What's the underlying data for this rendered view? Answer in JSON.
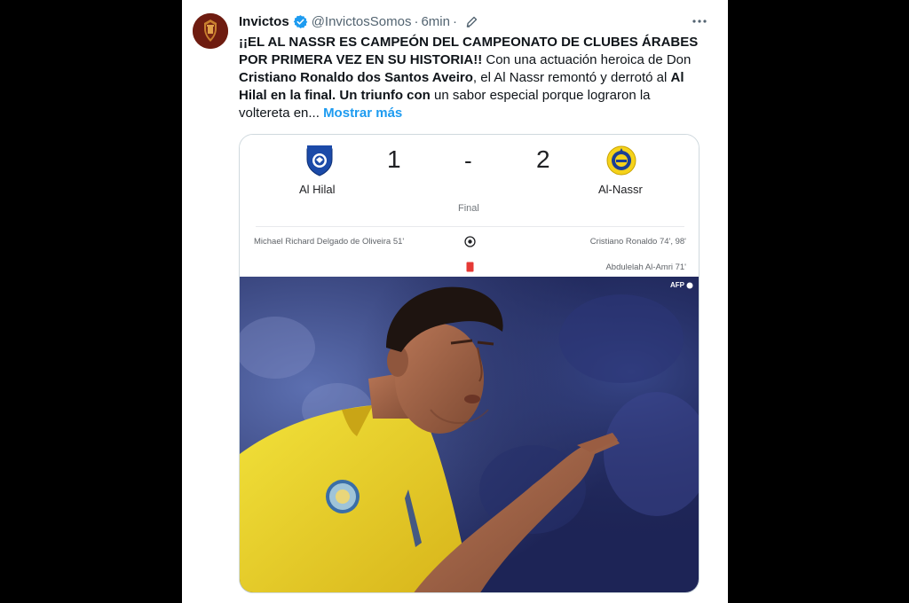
{
  "tweet": {
    "author": {
      "display_name": "Invictos",
      "handle": "@InvictosSomos",
      "verified": true
    },
    "timestamp": "6min",
    "text_bold_1": "¡¡EL AL NASSR ES CAMPEÓN DEL CAMPEONATO DE CLUBES ÁRABES POR PRIMERA VEZ EN SU HISTORIA!!",
    "text_plain_1": " Con una actuación heroica de Don ",
    "text_bold_2": "Cristiano Ronaldo dos Santos Aveiro",
    "text_plain_2": ", el Al Nassr remontó y derrotó al ",
    "text_bold_3": "Al Hilal en la final. Un triunfo con",
    "text_plain_3": " un sabor especial porque lograron la voltereta en...",
    "show_more_label": "Mostrar más"
  },
  "match": {
    "home": {
      "name": "Al Hilal",
      "score": "1"
    },
    "away": {
      "name": "Al-Nassr",
      "score": "2"
    },
    "separator": "-",
    "status": "Final",
    "events": {
      "home_goals": "Michael Richard Delgado de Oliveira 51'",
      "away_goals": "Cristiano Ronaldo 74', 98'",
      "away_red_card": "Abdulelah Al-Amri 71'"
    }
  },
  "photo": {
    "credit": "AFP"
  },
  "icons": {
    "verified": "verified-badge-icon",
    "edit": "edit-pencil-icon",
    "more": "more-dots-icon",
    "goal": "soccer-ball-icon",
    "red_card": "red-card-icon"
  },
  "colors": {
    "link": "#1d9bf0",
    "hilal_blue": "#1b4aa8",
    "nassr_yellow": "#f5d21a",
    "red_card": "#e53935"
  }
}
